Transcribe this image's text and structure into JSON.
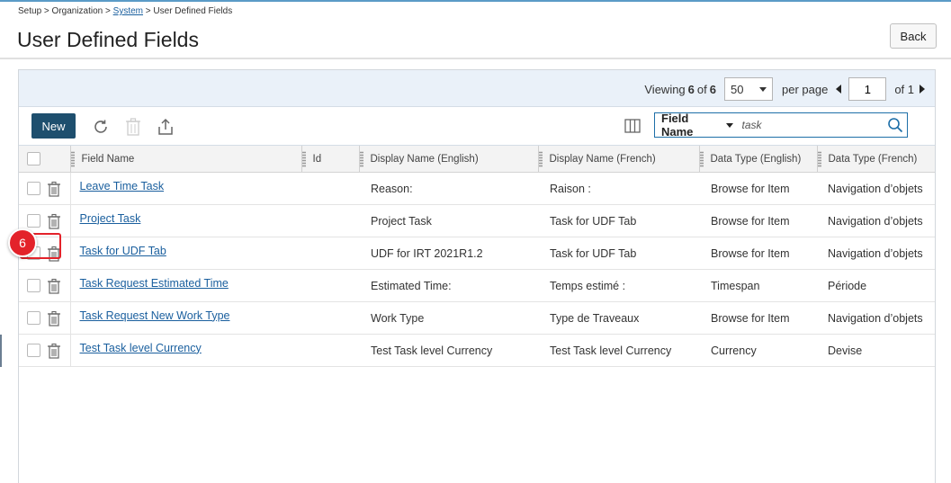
{
  "breadcrumb": {
    "setup": "Setup",
    "sep1": " > ",
    "org": "Organization",
    "sep2": " > ",
    "system": "System",
    "sep3": " > ",
    "current": "User Defined Fields"
  },
  "page": {
    "title": "User Defined Fields",
    "back_label": "Back"
  },
  "pager": {
    "viewing_label": "Viewing",
    "viewing_count": "6",
    "of_label": "of",
    "total": "6",
    "per_page_value": "50",
    "per_page_label": "per page",
    "page_number": "1",
    "page_of_label": "of 1"
  },
  "toolbar": {
    "new_label": "New"
  },
  "search": {
    "field_label": "Field Name",
    "query": "task"
  },
  "columns": [
    "Field Name",
    "Id",
    "Display Name (English)",
    "Display Name (French)",
    "Data Type (English)",
    "Data Type (French)"
  ],
  "rows": [
    {
      "field_name": "Leave Time Task",
      "id": "",
      "display_en": "Reason:",
      "display_fr": "Raison :",
      "type_en": "Browse for Item",
      "type_fr": "Navigation d’objets"
    },
    {
      "field_name": "Project Task",
      "id": "",
      "display_en": "Project Task",
      "display_fr": "Task for UDF Tab",
      "type_en": "Browse for Item",
      "type_fr": "Navigation d’objets"
    },
    {
      "field_name": "Task for UDF Tab",
      "id": "",
      "display_en": "UDF for IRT 2021R1.2",
      "display_fr": "Task for UDF Tab",
      "type_en": "Browse for Item",
      "type_fr": "Navigation d’objets"
    },
    {
      "field_name": "Task Request Estimated Time",
      "id": "",
      "display_en": "Estimated Time:",
      "display_fr": "Temps estimé :",
      "type_en": "Timespan",
      "type_fr": "Période"
    },
    {
      "field_name": "Task Request New Work Type",
      "id": "",
      "display_en": "Work Type",
      "display_fr": "Type de Traveaux",
      "type_en": "Browse for Item",
      "type_fr": "Navigation d’objets"
    },
    {
      "field_name": "Test Task level Currency",
      "id": "",
      "display_en": "Test Task level Currency",
      "display_fr": "Test Task level Currency",
      "type_en": "Currency",
      "type_fr": "Devise"
    }
  ],
  "annotation": {
    "step_number": "6"
  },
  "colors": {
    "accent": "#1e4f6e",
    "link": "#1a5f9e",
    "highlight": "#e3222a",
    "pager_bg": "#eaf1f9"
  },
  "icons": [
    "refresh-icon",
    "delete-icon",
    "export-icon",
    "columns-icon",
    "search-icon",
    "trash-icon"
  ]
}
